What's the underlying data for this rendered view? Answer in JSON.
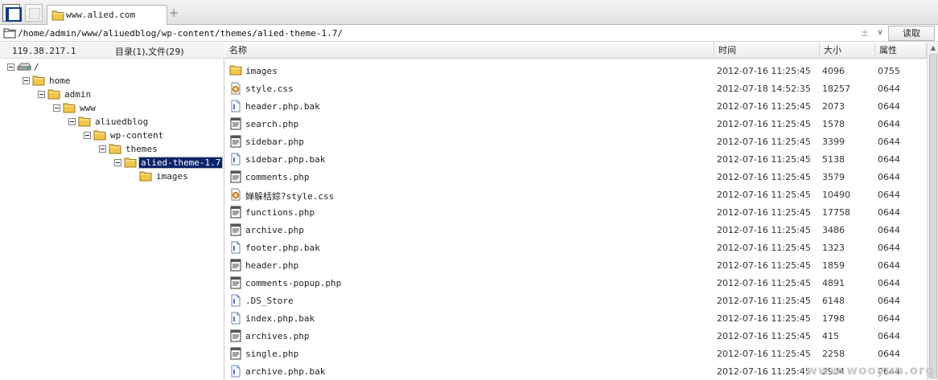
{
  "tabs": [
    {
      "title": "www.alied.com",
      "icon": "folder-icon"
    }
  ],
  "address_bar": {
    "path": "/home/admin/www/aliuedblog/wp-content/themes/alied-theme-1.7/",
    "read_button": "读取"
  },
  "left_panel": {
    "server_ip": "119.38.217.1",
    "summary": "目录(1),文件(29)",
    "tree": [
      {
        "label": "/",
        "icon": "drive-icon",
        "level": 0
      },
      {
        "label": "home",
        "icon": "folder-icon",
        "level": 1
      },
      {
        "label": "admin",
        "icon": "folder-icon",
        "level": 2
      },
      {
        "label": "www",
        "icon": "folder-icon",
        "level": 3
      },
      {
        "label": "aliuedblog",
        "icon": "folder-icon",
        "level": 4
      },
      {
        "label": "wp-content",
        "icon": "folder-icon",
        "level": 5
      },
      {
        "label": "themes",
        "icon": "folder-icon",
        "level": 6
      },
      {
        "label": "alied-theme-1.7",
        "icon": "folder-icon",
        "level": 7,
        "selected": true
      },
      {
        "label": "images",
        "icon": "folder-icon",
        "level": 8
      }
    ]
  },
  "file_list": {
    "columns": {
      "name": "名称",
      "time": "时间",
      "size": "大小",
      "attr": "属性"
    },
    "rows": [
      {
        "name": "images",
        "time": "2012-07-16 11:25:45",
        "size": "4096",
        "attr": "0755",
        "icon": "folder-icon"
      },
      {
        "name": "style.css",
        "time": "2012-07-18 14:52:35",
        "size": "18257",
        "attr": "0644",
        "icon": "css-file-icon"
      },
      {
        "name": "header.php.bak",
        "time": "2012-07-16 11:25:45",
        "size": "2073",
        "attr": "0644",
        "icon": "file-icon"
      },
      {
        "name": "search.php",
        "time": "2012-07-16 11:25:45",
        "size": "1578",
        "attr": "0644",
        "icon": "php-file-icon"
      },
      {
        "name": "sidebar.php",
        "time": "2012-07-16 11:25:45",
        "size": "3399",
        "attr": "0644",
        "icon": "php-file-icon"
      },
      {
        "name": "sidebar.php.bak",
        "time": "2012-07-16 11:25:45",
        "size": "5138",
        "attr": "0644",
        "icon": "file-icon"
      },
      {
        "name": "comments.php",
        "time": "2012-07-16 11:25:45",
        "size": "3579",
        "attr": "0644",
        "icon": "php-file-icon"
      },
      {
        "name": "婵躲栝婃?style.css",
        "time": "2012-07-16 11:25:45",
        "size": "10490",
        "attr": "0644",
        "icon": "css-file-icon"
      },
      {
        "name": "functions.php",
        "time": "2012-07-16 11:25:45",
        "size": "17758",
        "attr": "0644",
        "icon": "php-file-icon"
      },
      {
        "name": "archive.php",
        "time": "2012-07-16 11:25:45",
        "size": "3486",
        "attr": "0644",
        "icon": "php-file-icon"
      },
      {
        "name": "footer.php.bak",
        "time": "2012-07-16 11:25:45",
        "size": "1323",
        "attr": "0644",
        "icon": "file-icon"
      },
      {
        "name": "header.php",
        "time": "2012-07-16 11:25:45",
        "size": "1859",
        "attr": "0644",
        "icon": "php-file-icon"
      },
      {
        "name": "comments-popup.php",
        "time": "2012-07-16 11:25:45",
        "size": "4891",
        "attr": "0644",
        "icon": "php-file-icon"
      },
      {
        "name": ".DS_Store",
        "time": "2012-07-16 11:25:45",
        "size": "6148",
        "attr": "0644",
        "icon": "file-icon"
      },
      {
        "name": "index.php.bak",
        "time": "2012-07-16 11:25:45",
        "size": "1798",
        "attr": "0644",
        "icon": "file-icon"
      },
      {
        "name": "archives.php",
        "time": "2012-07-16 11:25:45",
        "size": "415",
        "attr": "0644",
        "icon": "php-file-icon"
      },
      {
        "name": "single.php",
        "time": "2012-07-16 11:25:45",
        "size": "2258",
        "attr": "0644",
        "icon": "php-file-icon"
      },
      {
        "name": "archive.php.bak",
        "time": "2012-07-16 11:25:45",
        "size": "2904",
        "attr": "0644",
        "icon": "file-icon"
      }
    ]
  },
  "watermark": "www.wooyun.org",
  "colors": {
    "selection": "#0a246a",
    "folder": "#f0c64c"
  }
}
